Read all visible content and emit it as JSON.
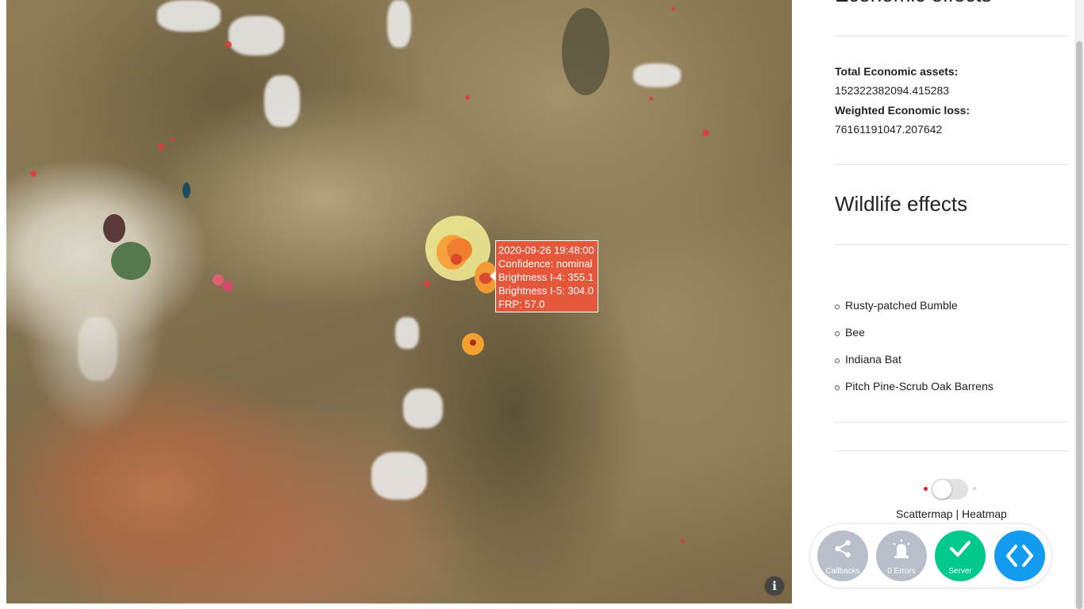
{
  "tooltip": {
    "datetime": "2020-09-26 19:48:00",
    "confidence": "Confidence: nominal",
    "brightness_i4": "Brightness I-4: 355.1",
    "brightness_i5": "Brightness I-5: 304.0",
    "frp": "FRP: 57.0"
  },
  "map": {
    "info_icon": "i"
  },
  "sidebar": {
    "economic_title": "Economic effects",
    "total_assets_label": "Total Economic assets:",
    "total_assets_value": "152322382094.415283",
    "weighted_loss_label": "Weighted Economic loss:",
    "weighted_loss_value": "76161191047.207642",
    "wildlife_title": "Wildlife effects",
    "species": [
      "Rusty-patched Bumble",
      "Bee",
      "Indiana Bat",
      "Pitch Pine-Scrub Oak Barrens"
    ],
    "toggle_label": "Scattermap | Heatmap"
  },
  "devtools": {
    "callbacks": "Callbacks",
    "errors": "0 Errors",
    "server": "Server"
  },
  "colors": {
    "tooltip_bg": "#e4573b",
    "server_green": "#00c98d",
    "toggle_blue": "#139bf0",
    "inactive_gray": "#b9bfca"
  }
}
